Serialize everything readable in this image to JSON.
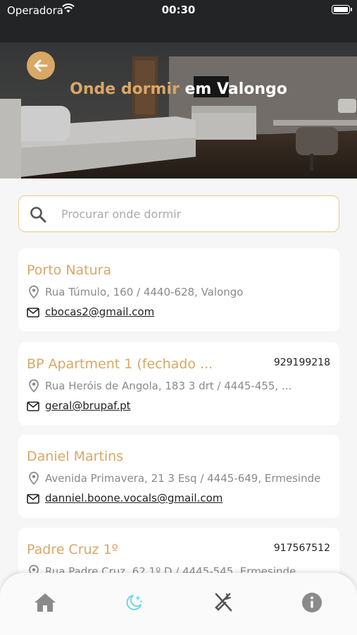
{
  "status_bar": {
    "carrier": "Operadora",
    "time": "00:30"
  },
  "header": {
    "title_accent": "Onde dormir",
    "title_rest": "em Valongo"
  },
  "search": {
    "placeholder": "Procurar onde dormir"
  },
  "listings": [
    {
      "name": "Porto Natura",
      "phone": "",
      "address": "Rua Túmulo, 160 / 4440-628, Valongo",
      "email": "cbocas2@gmail.com"
    },
    {
      "name": "BP Apartment 1 (fechado ...",
      "phone": "929199218",
      "address": "Rua Heróis de Angola, 183 3 drt / 4445-455, ...",
      "email": "geral@brupaf.pt"
    },
    {
      "name": "Daniel Martins",
      "phone": "",
      "address": "Avenida Primavera, 21 3 Esq / 4445-649, Ermesinde",
      "email": "danniel.boone.vocals@gmail.com"
    },
    {
      "name": "Padre Cruz 1º",
      "phone": "917567512",
      "address": "Rua Padre Cruz, 62 1º D / 4445-545, Ermesinde",
      "email": ""
    }
  ],
  "tabbar": {
    "items": [
      {
        "icon": "home-icon",
        "active": false
      },
      {
        "icon": "moon-stars-icon",
        "active": true
      },
      {
        "icon": "fork-knife-icon",
        "active": false
      },
      {
        "icon": "info-icon",
        "active": false
      }
    ],
    "active_color": "#5fd3e6",
    "inactive_color": "#8a8a8a"
  },
  "colors": {
    "accent": "#d9a766"
  }
}
